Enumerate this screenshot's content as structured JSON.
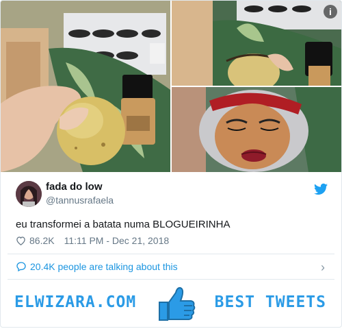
{
  "tweet": {
    "author_name": "fada do low",
    "author_handle": "@tannusrafaela",
    "text": "eu transformei a batata numa BLOGUEIRINHA",
    "likes": "86.2K",
    "timestamp": "11:11 PM - Dec 21, 2018",
    "conversation_label": "20.4K people are talking about this"
  },
  "media": {
    "info_badge": "i"
  },
  "footer": {
    "left_brand": "ELWIZARA.COM",
    "right_brand": "BEST TWEETS"
  },
  "colors": {
    "twitter_blue": "#1da1f2",
    "link_blue": "#1b95e0",
    "brand_blue": "#2b9be6",
    "muted": "#657786"
  },
  "icons": [
    "info-icon",
    "twitter-bird-icon",
    "heart-icon",
    "speech-bubble-icon",
    "chevron-right-icon",
    "thumbs-up-icon"
  ]
}
